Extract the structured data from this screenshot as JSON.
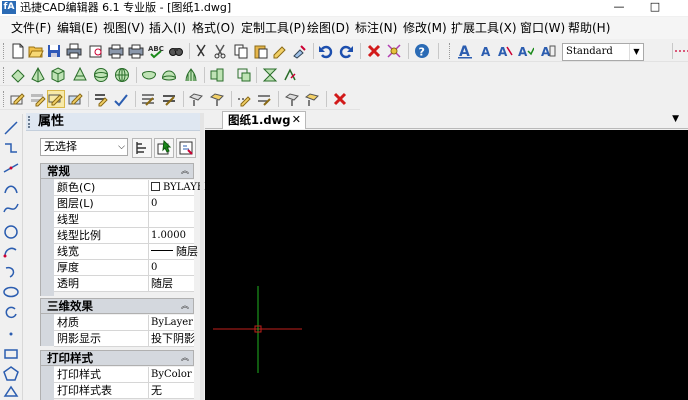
{
  "window": {
    "title": "迅捷CAD编辑器 6.1 专业版 - [图纸1.dwg]",
    "logo_text": "fA",
    "minimize": "—",
    "maximize": "□"
  },
  "menu": [
    "文件(F)",
    "编辑(E)",
    "视图(V)",
    "插入(I)",
    "格式(O)",
    "定制工具(P)",
    "绘图(D)",
    "标注(N)",
    "修改(M)",
    "扩展工具(X)",
    "窗口(W)",
    "帮助(H)"
  ],
  "toolbar": {
    "text_style": "Standard",
    "dropdown_arrow": "▼"
  },
  "properties": {
    "title": "属性",
    "selection": "无选择",
    "selection_arrow": "⌵",
    "sections": {
      "general": {
        "title": "常规",
        "rows": [
          {
            "key": "颜色(C)",
            "value": "BYLAYER"
          },
          {
            "key": "图层(L)",
            "value": "0"
          },
          {
            "key": "线型",
            "value": ""
          },
          {
            "key": "线型比例",
            "value": "1.0000"
          },
          {
            "key": "线宽",
            "value": "随层"
          },
          {
            "key": "厚度",
            "value": "0"
          },
          {
            "key": "透明",
            "value": "随层"
          }
        ]
      },
      "three_d": {
        "title": "三维效果",
        "rows": [
          {
            "key": "材质",
            "value": "ByLayer"
          },
          {
            "key": "阴影显示",
            "value": "投下阴影"
          }
        ]
      },
      "print_style": {
        "title": "打印样式",
        "rows": [
          {
            "key": "打印样式",
            "value": "ByColor"
          },
          {
            "key": "打印样式表",
            "value": "无"
          }
        ]
      }
    },
    "collapse_chevron": "︽"
  },
  "document": {
    "tab_name": "图纸1.dwg",
    "tab_close": "✕",
    "tab_menu": "▼"
  },
  "colors": {
    "canvas": "#000000",
    "crosshair_x": "#c0201b",
    "crosshair_y": "#1fb21f",
    "accent": "#2b6bb5"
  },
  "icons": {
    "toolbar1": [
      "new-file-icon",
      "open-folder-icon",
      "save-icon",
      "print-icon",
      "print-preview-icon",
      "plot-icon",
      "spellcheck-icon",
      "find-icon",
      "cut-icon",
      "copy-icon",
      "paste-icon",
      "match-properties-icon",
      "undo-icon",
      "redo-icon",
      "delete-icon",
      "pick-icon",
      "help-icon",
      "text-a-icon",
      "text-a-small-icon",
      "text-style-icon",
      "text-edit-icon"
    ],
    "toolbar2": [
      "box-icon",
      "pyramid-icon",
      "cube-icon",
      "cone-icon",
      "sphere-icon",
      "grid-sphere-icon",
      "dish-icon",
      "dome-icon",
      "mesh-icon",
      "edges-icon",
      "layers-icon",
      "transfer-icon"
    ],
    "toolbar3": [
      "dim-icon-1",
      "dim-icon-2",
      "dim-icon-3",
      "dim-icon-4",
      "dim-icon-5",
      "dim-icon-6",
      "dim-icon-7",
      "dim-icon-8",
      "dim-icon-9",
      "dim-icon-10",
      "dim-icon-11",
      "dim-icon-12",
      "dim-icon-13",
      "close-red-icon"
    ]
  }
}
